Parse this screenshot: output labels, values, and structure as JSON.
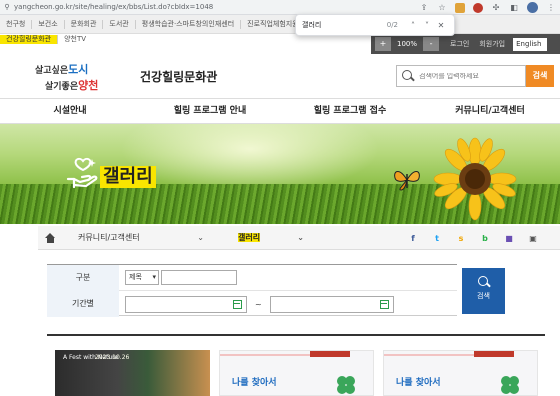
{
  "browser": {
    "url": "yangcheon.go.kr/site/healing/ex/bbs/List.do?cbIdx=1048",
    "find_query": "갤러리",
    "find_count": "0/2"
  },
  "topbar": {
    "links": [
      "천구청",
      "보건소",
      "문화회관",
      "도서관",
      "평생학습관·스마트창의인재센터",
      "진로직업체험지원"
    ],
    "highlight_link": "건강힐링문화관",
    "tv": "양천TV",
    "zoom_minus": "+",
    "zoom_value": "100%",
    "zoom_plus": "-",
    "login": "로그인",
    "join": "회원가입",
    "lang": "English"
  },
  "header": {
    "logo_line1_a": "살고싶은",
    "logo_line1_b": "도시",
    "logo_line2_a": "살기좋은",
    "logo_line2_b": "양천",
    "site_title": "건강힐링문화관",
    "search_placeholder": "검색어를 입력하세요",
    "search_button": "검색"
  },
  "gnb": [
    "시설안내",
    "힐링 프로그램 안내",
    "힐링 프로그램 접수",
    "커뮤니티/고객센터"
  ],
  "banner": {
    "title": "갤러리"
  },
  "location": {
    "depth1": "커뮤니티/고객센터",
    "depth2": "갤러리"
  },
  "sns": [
    {
      "icon": "facebook-icon",
      "glyph": "f",
      "color": "#3b5998"
    },
    {
      "icon": "twitter-icon",
      "glyph": "t",
      "color": "#1da1f2"
    },
    {
      "icon": "kakao-story-icon",
      "glyph": "s",
      "color": "#f0a500"
    },
    {
      "icon": "band-icon",
      "glyph": "b",
      "color": "#2ab149"
    },
    {
      "icon": "bookmark-icon",
      "glyph": "■",
      "color": "#6a4fb3"
    },
    {
      "icon": "print-icon",
      "glyph": "▣",
      "color": "#555555"
    }
  ],
  "form": {
    "label_type": "구분",
    "select_value": "제목",
    "label_period": "기간별",
    "tilde": "~",
    "search_button": "검색"
  },
  "gallery": {
    "thumb1_caption": "A Fest with Nature",
    "thumb1_date": "2023.10.26",
    "thumb2_title": "나를 찾아서",
    "thumb3_title": "나를 찾아서"
  }
}
